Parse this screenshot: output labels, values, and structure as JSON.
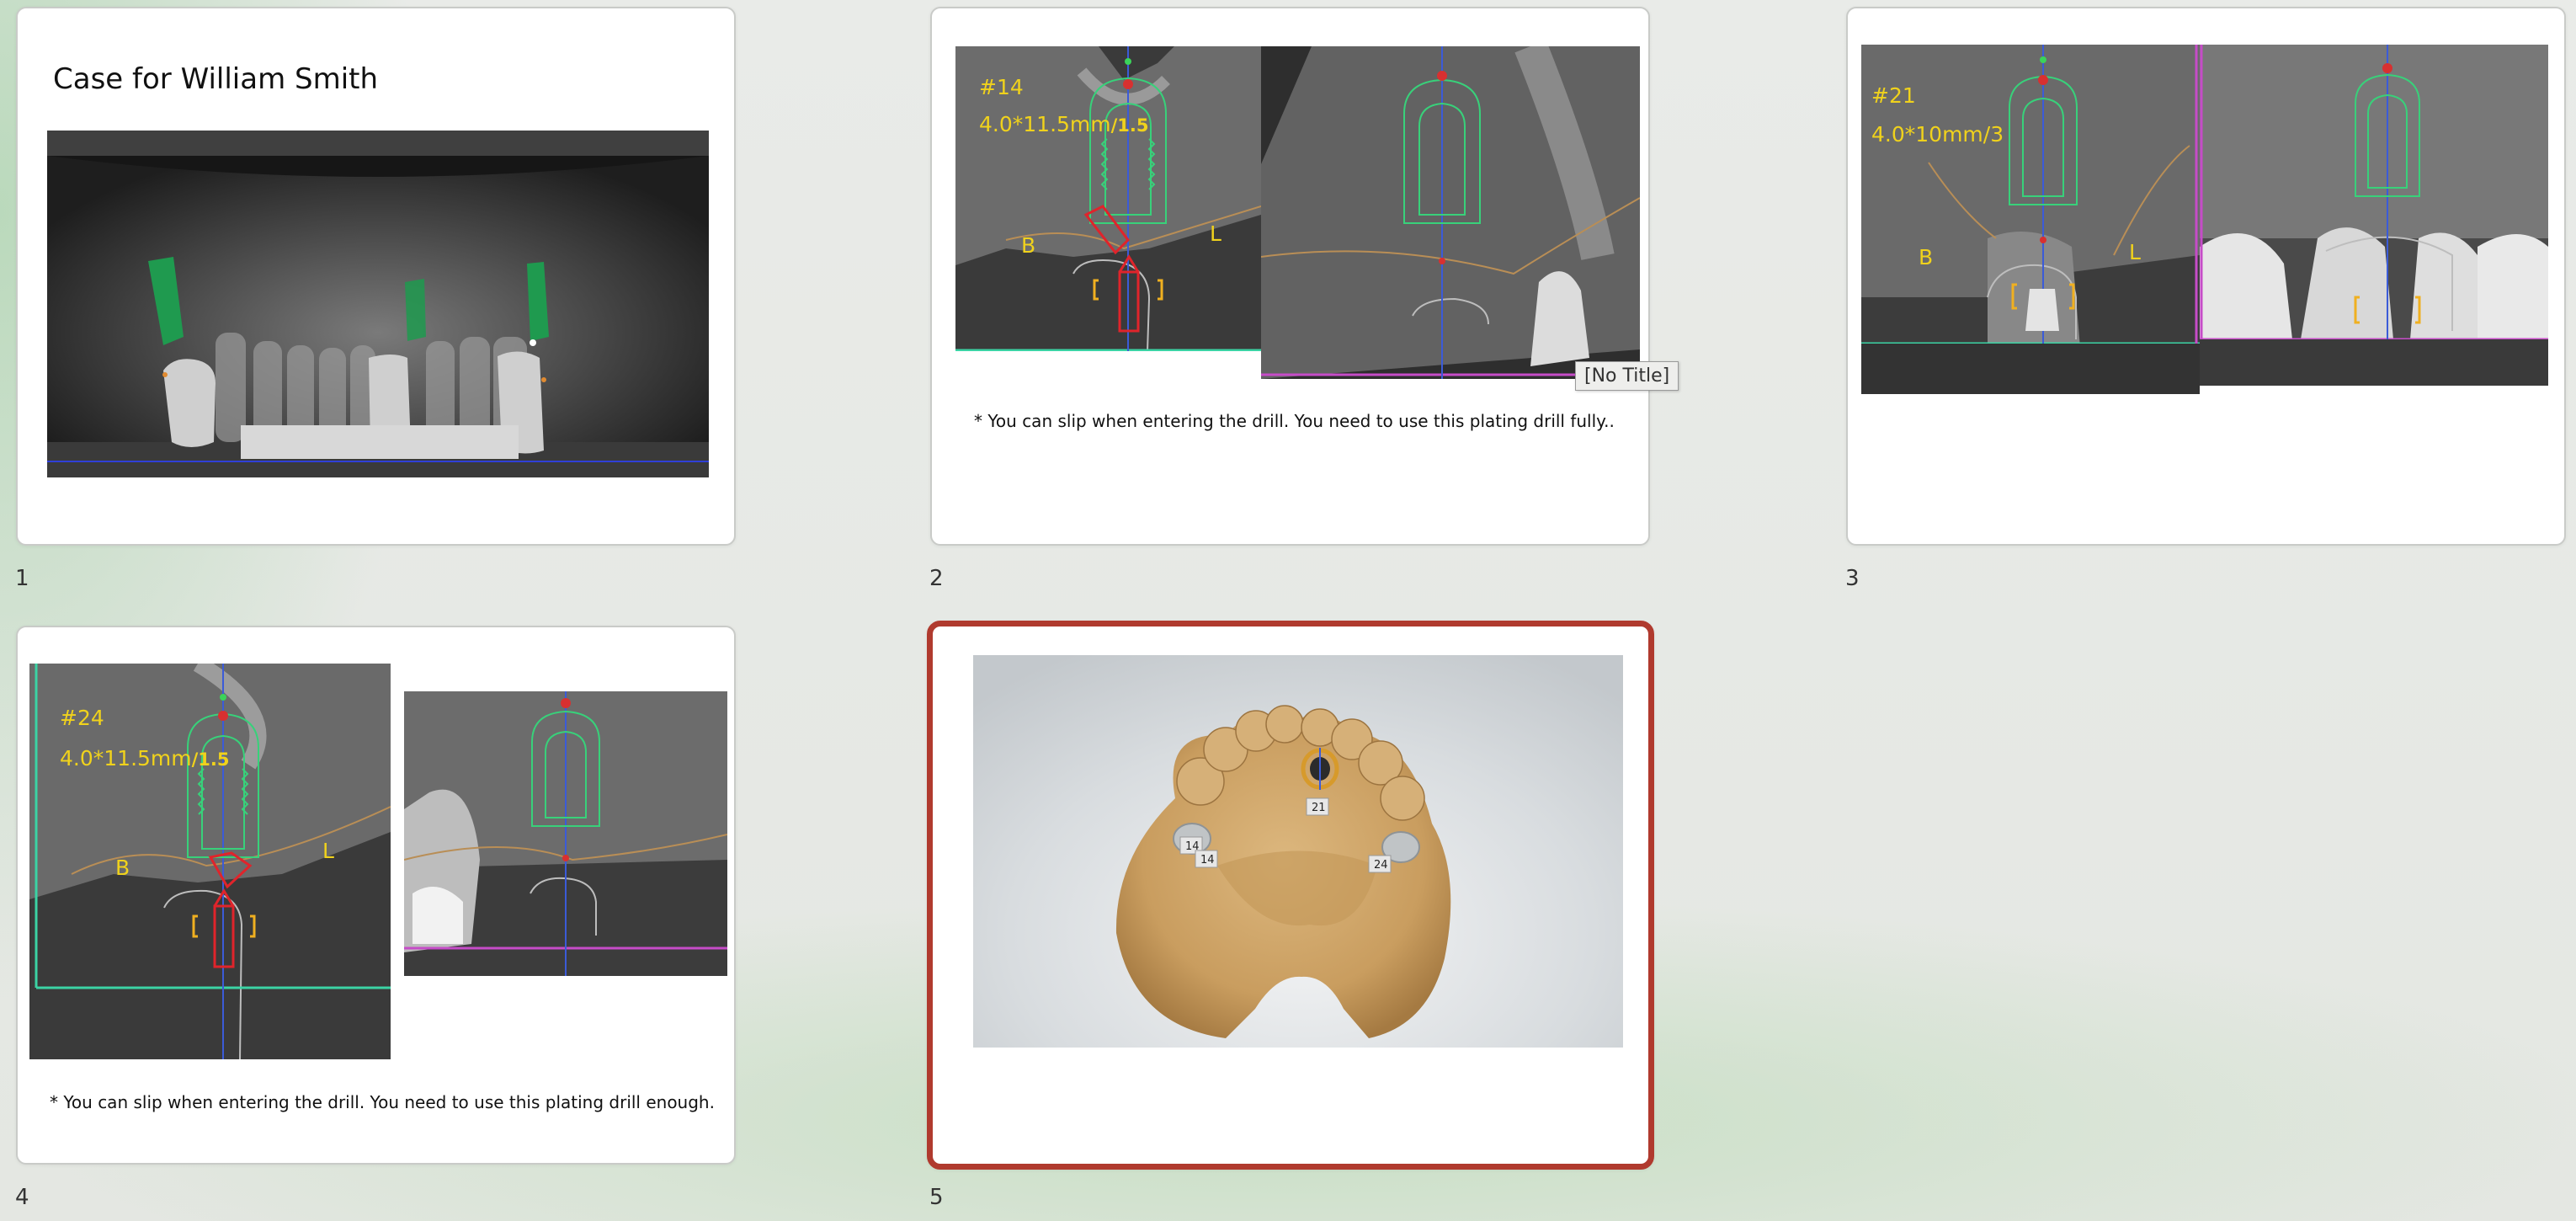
{
  "slides": [
    {
      "number": "1",
      "title": "Case for William Smith"
    },
    {
      "number": "2",
      "tooth": "#14",
      "implant": "4.0*11.5mm",
      "suffix": "/1.5",
      "buccal": "B",
      "lingual": "L",
      "note": "* You can slip when entering the drill.  You need to use this plating drill fully.."
    },
    {
      "number": "3",
      "tooth": "#21",
      "implant": "4.0*10mm/3",
      "buccal": "B",
      "lingual": "L"
    },
    {
      "number": "4",
      "tooth": "#24",
      "implant": "4.0*11.5mm",
      "suffix": "/1.5",
      "buccal": "B",
      "lingual": "L",
      "note": "* You can slip when entering the drill.  You need to use this plating drill enough."
    },
    {
      "number": "5",
      "model_tags": [
        "21",
        "14",
        "14",
        "24"
      ]
    }
  ],
  "selected_slide": "5",
  "tooltip": "[No Title]",
  "colors": {
    "selection_border": "#b03a2e",
    "implant_outline": "#38d17a",
    "annotation": "#f0d21c",
    "drill": "#e0242b"
  }
}
